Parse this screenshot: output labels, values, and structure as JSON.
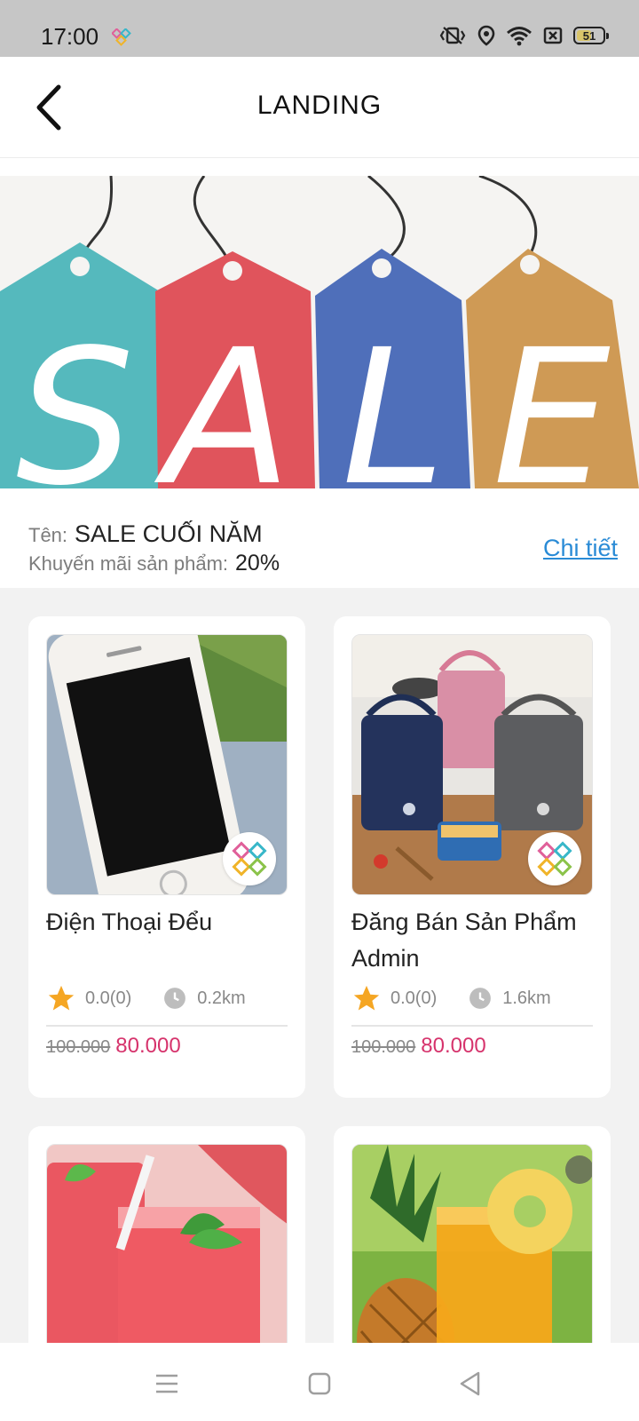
{
  "status_bar": {
    "time": "17:00",
    "battery": "51"
  },
  "header": {
    "title": "LANDING"
  },
  "banner": {
    "letters": [
      "S",
      "A",
      "L",
      "E"
    ],
    "tag_colors": [
      "#55b9bd",
      "#e0545c",
      "#4f6fba",
      "#cf9a55"
    ]
  },
  "promo": {
    "name_label": "Tên:",
    "name": "SALE CUỐI NĂM",
    "discount_label": "Khuyến mãi sản phẩm:",
    "discount": "20%",
    "detail_link": "Chi tiết"
  },
  "products": [
    {
      "title": "Điện Thoại Đểu",
      "rating": "0.0(0)",
      "distance": "0.2km",
      "old_price": "100.000",
      "new_price": "80.000"
    },
    {
      "title": "Đăng Bán Sản Phẩm Admin",
      "rating": "0.0(0)",
      "distance": "1.6km",
      "old_price": "100.000",
      "new_price": "80.000"
    },
    {
      "title": "",
      "rating": "",
      "distance": "",
      "old_price": "",
      "new_price": ""
    },
    {
      "title": "",
      "rating": "",
      "distance": "",
      "old_price": "",
      "new_price": ""
    }
  ],
  "icons": {
    "back": "chevron-left-icon",
    "star": "star-icon",
    "clock": "clock-icon",
    "nav": [
      "menu-icon",
      "home-square-icon",
      "back-triangle-icon"
    ]
  },
  "colors": {
    "accent_link": "#2a8bd6",
    "price": "#d6336c",
    "star": "#f5a623"
  }
}
